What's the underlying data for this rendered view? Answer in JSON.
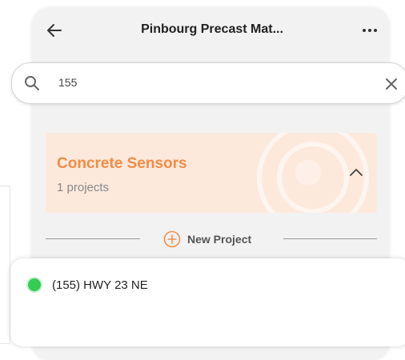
{
  "header": {
    "title": "Pinbourg Precast Mat...",
    "back_icon": "arrow-left-icon",
    "more_icon": "more-horizontal-icon"
  },
  "search": {
    "value": "155",
    "search_icon": "search-icon",
    "clear_icon": "close-icon"
  },
  "group": {
    "title": "Concrete Sensors",
    "subtitle": "1 projects",
    "chevron_icon": "chevron-up-icon"
  },
  "new_project": {
    "label": "New Project",
    "icon": "plus-circle-icon"
  },
  "project": {
    "name": "(155) HWY 23 NE",
    "status_color": "#33cc55"
  },
  "colors": {
    "accent": "#f28c45",
    "group_bg": "#fde9dc",
    "screen_bg": "#f2f2f2"
  }
}
